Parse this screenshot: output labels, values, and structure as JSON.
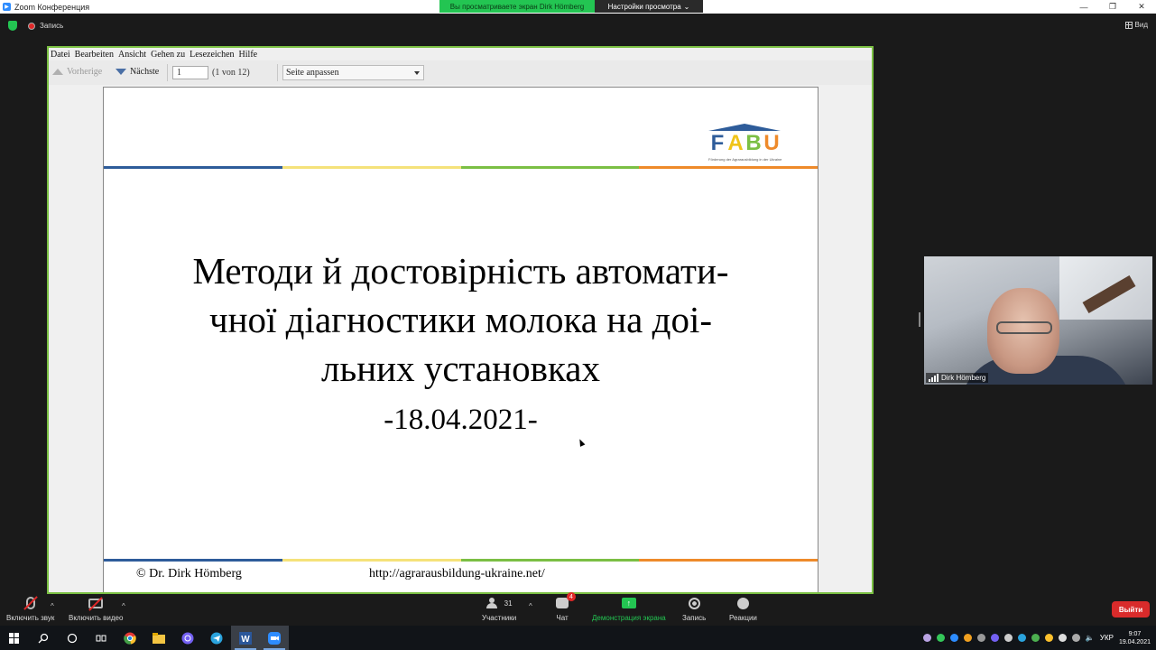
{
  "window": {
    "title": "Zoom Конференция",
    "share_banner": "Вы просматриваете экран Dirk Hömberg",
    "view_options": "Настройки просмотра",
    "recording": "Запись",
    "view": "Вид"
  },
  "pdf": {
    "menu": [
      "Datei",
      "Bearbeiten",
      "Ansicht",
      "Gehen zu",
      "Lesezeichen",
      "Hilfe"
    ],
    "prev": "Vorherige",
    "next": "Nächste",
    "page_value": "1",
    "page_count": "(1 von 12)",
    "zoom": "Seite anpassen"
  },
  "slide": {
    "logo": "FABU",
    "logo_sub": "Förderung der Agrarausbildung in der Ukraine",
    "logo_colors": [
      "#2e5c9a",
      "#f0c419",
      "#7bbf44",
      "#ee8a2a"
    ],
    "rule_colors": [
      "#2e5c9a",
      "#f5e27a",
      "#7bbf44",
      "#ee8a2a"
    ],
    "line1": "Методи й достовірність автомати-",
    "line2": "чної діагностики молока на доі-",
    "line3": "льних установках",
    "date": "-18.04.2021-",
    "author": "© Dr. Dirk Hömberg",
    "url": "http://agrarausbildung-ukraine.net/"
  },
  "video": {
    "name": "Dirk Hömberg"
  },
  "controls": {
    "audio": "Включить звук",
    "video": "Включить видео",
    "participants": "Участники",
    "participants_count": "31",
    "chat": "Чат",
    "chat_badge": "4",
    "share": "Демонстрация экрана",
    "record": "Запись",
    "reactions": "Реакции",
    "leave": "Выйти"
  },
  "taskbar": {
    "lang": "УКР",
    "time": "9:07",
    "date": "19.04.2021"
  },
  "colors": {
    "zoom_green": "#23c552",
    "share_border": "#7bc043",
    "leave_red": "#d92b2b"
  }
}
